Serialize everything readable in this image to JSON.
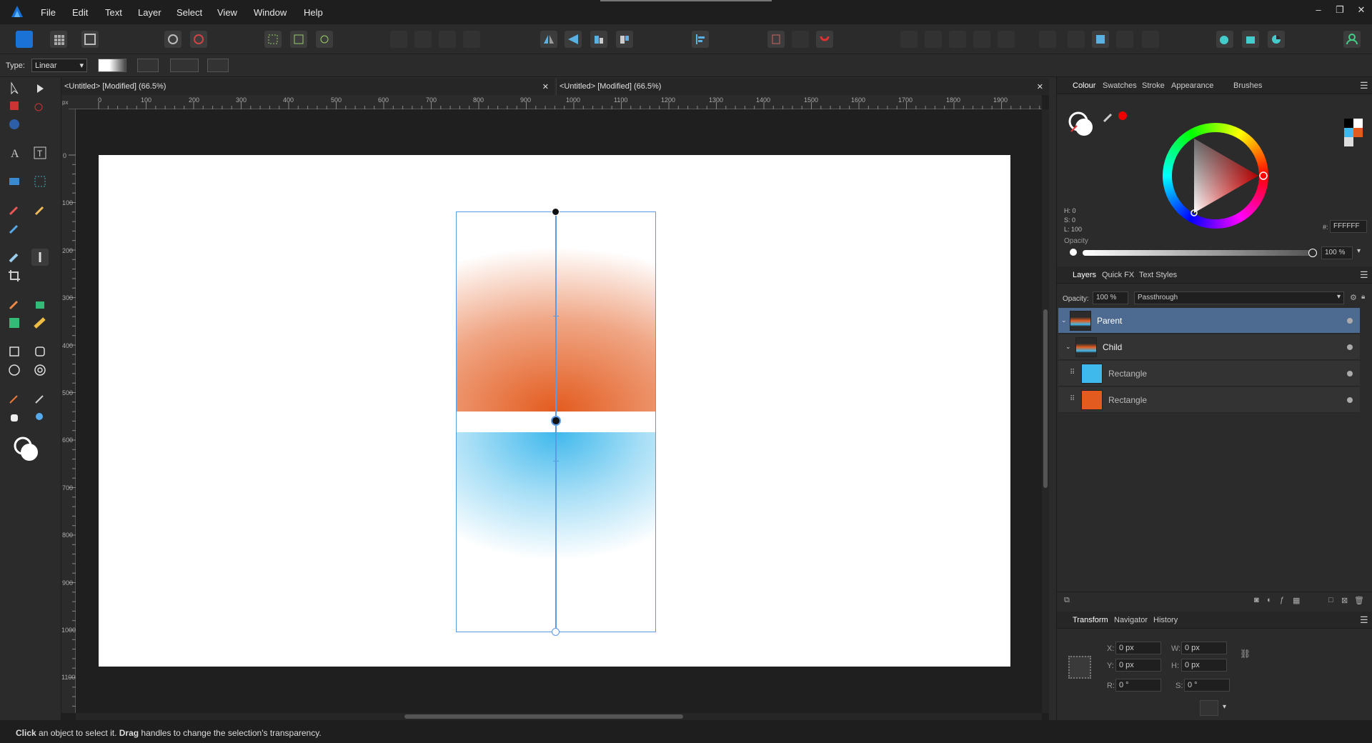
{
  "app": {
    "name": "Affinity Designer"
  },
  "menu": [
    "File",
    "Edit",
    "Text",
    "Layer",
    "Select",
    "View",
    "Window",
    "Help"
  ],
  "window_controls": [
    "–",
    "❐",
    "✕"
  ],
  "context": {
    "type_label": "Type:",
    "type_value": "Linear"
  },
  "tabs": [
    {
      "title": "<Untitled> [Modified] (66.5%)",
      "close": "✕"
    },
    {
      "title": "<Untitled> [Modified] (66.5%)",
      "close": "✕"
    }
  ],
  "ruler": {
    "unit": "px",
    "h_ticks": [
      "0",
      "100",
      "200",
      "300",
      "400",
      "500",
      "600",
      "700",
      "800",
      "900",
      "1000",
      "1100",
      "1200",
      "1300",
      "1400",
      "1500",
      "1600",
      "1700",
      "1800",
      "1900"
    ],
    "v_ticks": [
      "0",
      "100",
      "200",
      "300",
      "400",
      "500",
      "600",
      "700",
      "800",
      "900",
      "1000",
      "1100"
    ]
  },
  "colour_panel": {
    "tabs": [
      "Colour",
      "Swatches",
      "Stroke",
      "Appearance",
      "Brushes"
    ],
    "h": "H: 0",
    "s": "S: 0",
    "l": "L: 100",
    "hex_label": "#:",
    "hex": "FFFFFF",
    "opacity_label": "Opacity",
    "opacity": "100 %"
  },
  "layers_panel": {
    "tabs": [
      "Layers",
      "Quick FX",
      "Text Styles"
    ],
    "opacity_label": "Opacity:",
    "opacity": "100 %",
    "blend": "Passthrough",
    "layers": [
      {
        "name": "Parent",
        "selected": true
      },
      {
        "name": "Child",
        "selected": false
      },
      {
        "name": "Rectangle",
        "color": "#3fb8ec",
        "selected": false
      },
      {
        "name": "Rectangle",
        "color": "#e35b1e",
        "selected": false
      }
    ]
  },
  "transform_panel": {
    "tabs": [
      "Transform",
      "Navigator",
      "History"
    ],
    "x_label": "X:",
    "x": "0 px",
    "y_label": "Y:",
    "y": "0 px",
    "w_label": "W:",
    "w": "0 px",
    "h_label": "H:",
    "h": "0 px",
    "r_label": "R:",
    "r": "0 °",
    "s_label": "S:",
    "s": "0 °"
  },
  "status": {
    "click": "Click",
    "t1": " an object to select it. ",
    "drag": "Drag",
    "t2": " handles to change the selection's transparency."
  },
  "colors": {
    "orange": "#e35b1e",
    "blue": "#3fb8ec",
    "accent": "#4d6a91"
  }
}
